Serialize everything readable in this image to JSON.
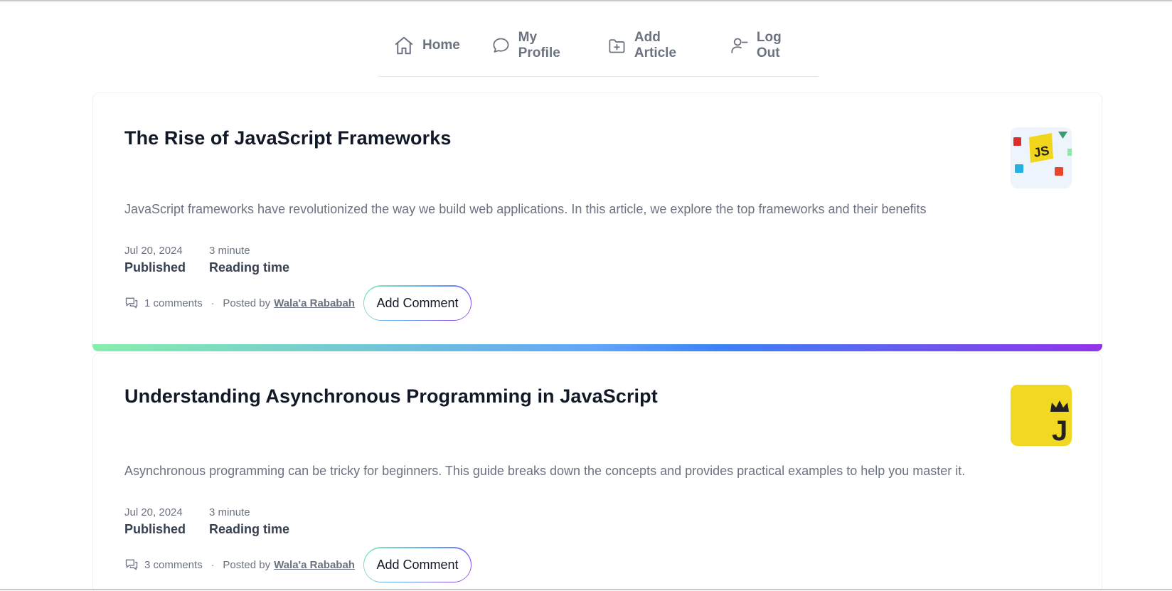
{
  "nav": {
    "items": [
      {
        "label": "Home",
        "icon": "home-icon"
      },
      {
        "label": "My Profile",
        "icon": "chat-bubble-icon"
      },
      {
        "label": "Add Article",
        "icon": "folder-plus-icon"
      },
      {
        "label": "Log Out",
        "icon": "user-minus-icon"
      }
    ]
  },
  "articles": [
    {
      "title": "The Rise of JavaScript Frameworks",
      "thumbnail": "js-frameworks-thumbnail",
      "excerpt": "JavaScript frameworks have revolutionized the way we build web applications. In this article, we explore the top frameworks and their benefits",
      "date": "Jul 20, 2024",
      "status": "Published",
      "reading_value": "3 minute",
      "reading_label": "Reading time",
      "comments": "1 comments",
      "posted_by": "Posted by",
      "author": "Wala'a Rababah",
      "button": "Add Comment",
      "thumb_text": "JS"
    },
    {
      "title": "Understanding Asynchronous Programming in JavaScript",
      "thumbnail": "js-crown-thumbnail",
      "excerpt": "Asynchronous programming can be tricky for beginners. This guide breaks down the concepts and provides practical examples to help you master it.",
      "date": "Jul 20, 2024",
      "status": "Published",
      "reading_value": "3 minute",
      "reading_label": "Reading time",
      "comments": "3 comments",
      "posted_by": "Posted by",
      "author": "Wala'a Rababah",
      "button": "Add Comment",
      "thumb_text": "J"
    }
  ],
  "colors": {
    "gradient_start": "#86efac",
    "gradient_mid": "#3b82f6",
    "gradient_end": "#9333ea",
    "js_yellow": "#f1d823"
  }
}
